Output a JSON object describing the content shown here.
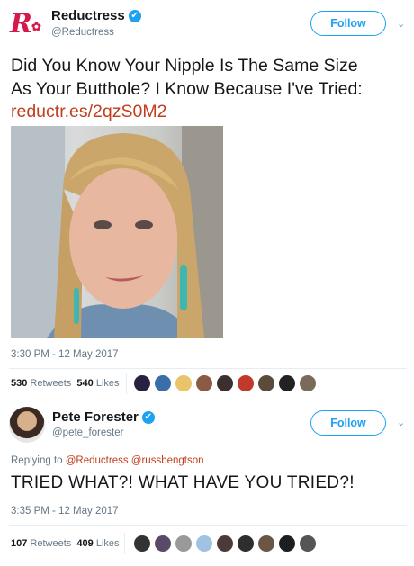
{
  "tweet1": {
    "author": {
      "name": "Reductress",
      "handle": "@Reductress",
      "verified": true
    },
    "follow_label": "Follow",
    "text_line1": "Did You Know Your Nipple Is The Same Size",
    "text_line2": "As Your Butthole? I Know Because I've Tried:",
    "link": "reductr.es/2qzS0M2",
    "timestamp": "3:30 PM - 12 May 2017",
    "retweets_count": "530",
    "retweets_label": "Retweets",
    "likes_count": "540",
    "likes_label": "Likes"
  },
  "tweet2": {
    "author": {
      "name": "Pete Forester",
      "handle": "@pete_forester",
      "verified": true
    },
    "follow_label": "Follow",
    "replying_label": "Replying to",
    "replying_handle1": "@Reductress",
    "replying_handle2": "@russbengtson",
    "text": "TRIED WHAT?! WHAT HAVE YOU TRIED?!",
    "timestamp": "3:35 PM - 12 May 2017",
    "retweets_count": "107",
    "retweets_label": "Retweets",
    "likes_count": "409",
    "likes_label": "Likes"
  },
  "colors": {
    "accent": "#1da1f2",
    "link": "#c23e1d",
    "brand": "#d6194b"
  },
  "icons": {
    "verified": "verified-badge-icon",
    "chevron": "chevron-down-icon"
  }
}
